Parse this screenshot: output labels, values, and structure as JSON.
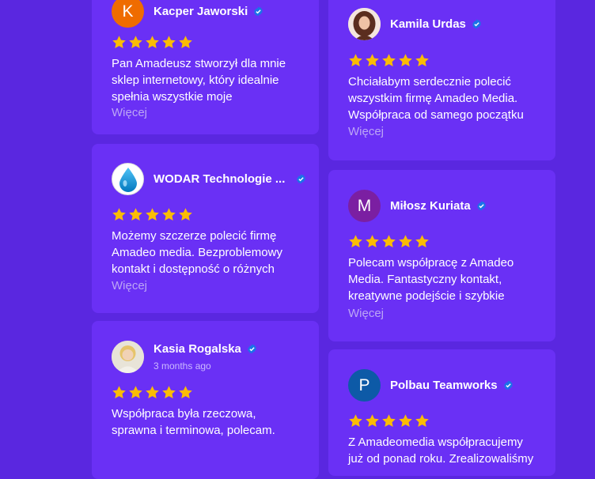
{
  "reviews": [
    {
      "name": "Kacper Jaworski",
      "avatar_letter": "K",
      "avatar_color": "#ef6c00",
      "text": "Pan Amadeusz stworzył dla mnie sklep internetowy, który idealnie spełnia wszystkie moje",
      "more": "Więcej",
      "rating": 5
    },
    {
      "name": "WODAR Technologie ...",
      "avatar_icon": "water-drop-icon",
      "text": "Możemy szczerze polecić firmę Amadeo media. Bezproblemowy kontakt i dostępność o różnych",
      "more": "Więcej",
      "rating": 5
    },
    {
      "name": "Kasia Rogalska",
      "sub": "3 months ago",
      "avatar_icon": "photo-avatar-icon",
      "text": "Współpraca była rzeczowa, sprawna i terminowa, polecam.",
      "rating": 5
    },
    {
      "name": "Kamila Urdas",
      "avatar_icon": "photo-avatar-icon",
      "text": "Chciałabym serdecznie polecić wszystkim firmę Amadeo Media. Współpraca od samego początku",
      "more": "Więcej",
      "rating": 5
    },
    {
      "name": "Miłosz Kuriata",
      "avatar_letter": "M",
      "avatar_color": "#7b1fa2",
      "text": "Polecam współpracę z Amadeo Media. Fantastyczny kontakt, kreatywne podejście i szybkie",
      "more": "Więcej",
      "rating": 5
    },
    {
      "name": "Polbau Teamworks",
      "avatar_letter": "P",
      "avatar_color": "#0d5aa7",
      "text": "Z Amadeomedia współpracujemy już od ponad roku. Zrealizowaliśmy",
      "rating": 5
    }
  ],
  "colors": {
    "background": "#5a27e0",
    "card": "#6a30f5",
    "star": "#fbbc04",
    "verified": "#1a73e8",
    "more_link": "#bca6f5"
  }
}
